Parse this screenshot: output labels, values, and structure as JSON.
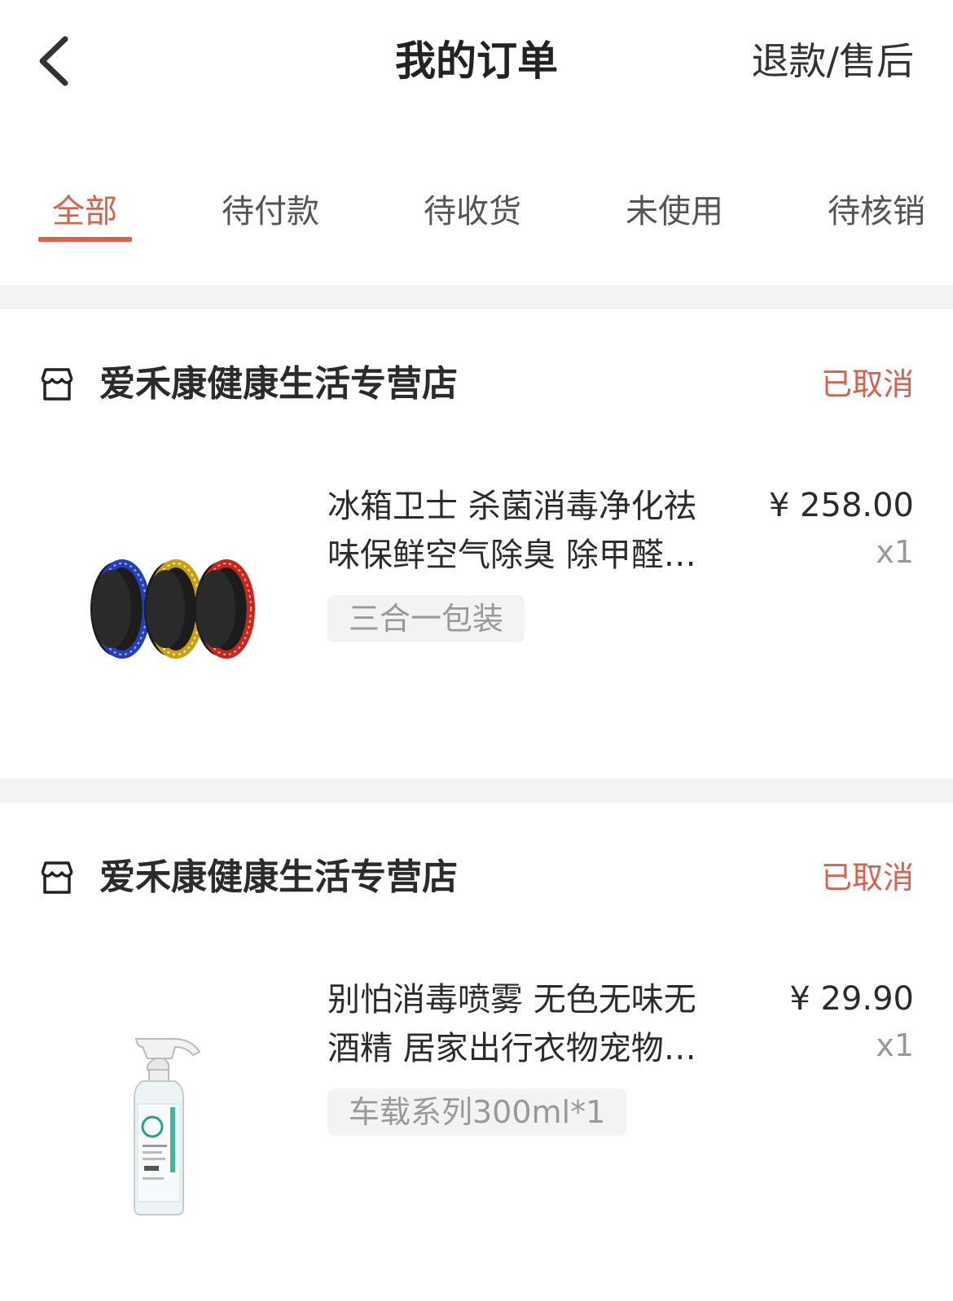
{
  "header": {
    "title": "我的订单",
    "refund_label": "退款/售后"
  },
  "tabs": [
    {
      "label": "全部",
      "active": true
    },
    {
      "label": "待付款",
      "active": false
    },
    {
      "label": "待收货",
      "active": false
    },
    {
      "label": "未使用",
      "active": false
    },
    {
      "label": "待核销",
      "active": false
    }
  ],
  "orders": [
    {
      "store": "爱禾康健康生活专营店",
      "status": "已取消",
      "product": {
        "name_line1": "冰箱卫士 杀菌消毒净化祛",
        "name_line2": "味保鲜空气除臭 除甲醛…",
        "price": "¥ 258.00",
        "qty": "x1",
        "spec": "三合一包装"
      }
    },
    {
      "store": "爱禾康健康生活专营店",
      "status": "已取消",
      "product": {
        "name_line1": "别怕消毒喷雾 无色无味无",
        "name_line2": "酒精 居家出行衣物宠物…",
        "price": "¥ 29.90",
        "qty": "x1",
        "spec": "车载系列300ml*1"
      }
    }
  ],
  "colors": {
    "accent": "#d5634f",
    "divider": "#f3f3f3",
    "text": "#2b2b2b",
    "muted": "#999999"
  },
  "icons": {
    "back": "chevron-left-icon",
    "store": "store-icon"
  }
}
